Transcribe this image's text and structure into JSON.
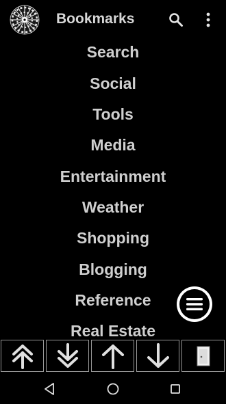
{
  "appbar": {
    "title": "Bookmarks",
    "logo_icon": "dartboard-icon",
    "search_icon": "search-icon",
    "overflow_icon": "more-vertical-icon"
  },
  "bookmarks": [
    {
      "label": "Search"
    },
    {
      "label": "Social"
    },
    {
      "label": "Tools"
    },
    {
      "label": "Media"
    },
    {
      "label": "Entertainment"
    },
    {
      "label": "Weather"
    },
    {
      "label": "Shopping"
    },
    {
      "label": "Blogging"
    },
    {
      "label": "Reference"
    },
    {
      "label": "Real Estate"
    }
  ],
  "fab": {
    "icon": "hamburger-menu-icon"
  },
  "toolbar": {
    "buttons": [
      {
        "icon": "double-arrow-up-icon"
      },
      {
        "icon": "double-arrow-down-icon"
      },
      {
        "icon": "arrow-up-icon"
      },
      {
        "icon": "arrow-down-icon"
      },
      {
        "icon": "exit-door-icon"
      }
    ]
  },
  "navbar": {
    "back_icon": "nav-back-icon",
    "home_icon": "nav-home-icon",
    "recents_icon": "nav-recents-icon"
  },
  "colors": {
    "background": "#000000",
    "text": "#cfcfcf",
    "border": "#9a9a9a"
  }
}
